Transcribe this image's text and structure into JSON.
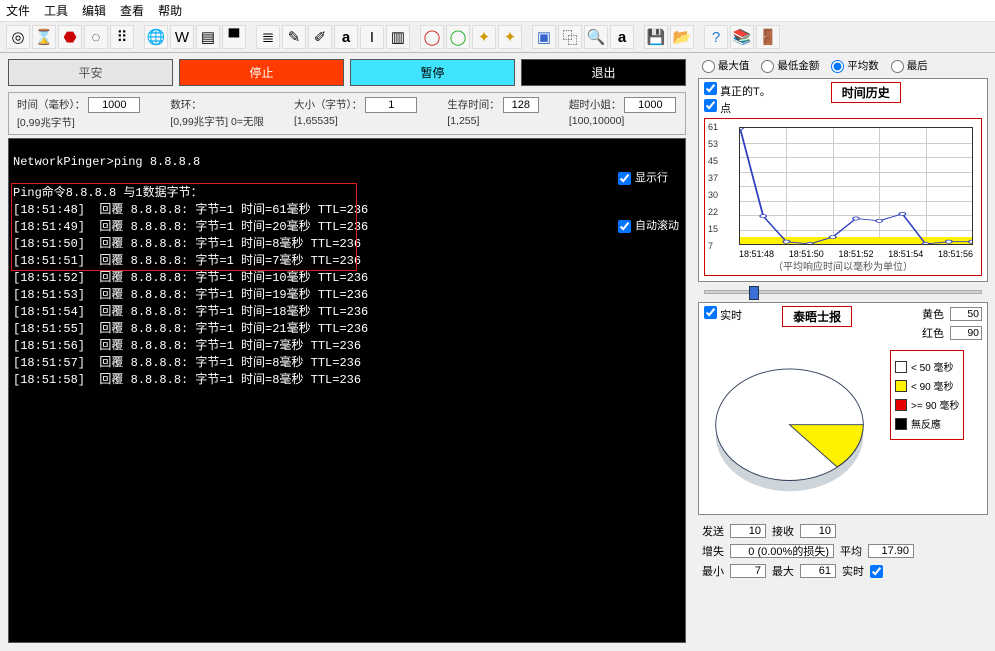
{
  "menu": {
    "file": "文件",
    "tools": "工具",
    "edit": "编辑",
    "view": "查看",
    "help": "帮助"
  },
  "buttons": {
    "ping": "平安",
    "stop": "停止",
    "pause": "暂停",
    "exit": "退出"
  },
  "params": {
    "time_label": "时间（毫秒）：",
    "time_hint": "[0,99兆字节]",
    "time_val": "1000",
    "count_label": "数环：",
    "count_hint": "[0,99兆字节] 0=无限",
    "count_val": "",
    "size_label": "大小（字节）：",
    "size_hint": "[1,65535]",
    "size_val": "1",
    "ttl_label": "生存时间：",
    "ttl_hint": "[1,255]",
    "ttl_val": "128",
    "timeout_label": "超时小姐：",
    "timeout_hint": "[100,10000]",
    "timeout_val": "1000"
  },
  "console": {
    "prompt": "NetworkPinger>ping 8.8.8.8",
    "header": "Ping命令8.8.8.8 与1数据字节：",
    "lines": [
      "[18:51:48]  回覆 8.8.8.8: 字节=1 时间=61毫秒 TTL=236",
      "[18:51:49]  回覆 8.8.8.8: 字节=1 时间=20毫秒 TTL=236",
      "[18:51:50]  回覆 8.8.8.8: 字节=1 时间=8毫秒 TTL=236",
      "[18:51:51]  回覆 8.8.8.8: 字节=1 时间=7毫秒 TTL=236",
      "[18:51:52]  回覆 8.8.8.8: 字节=1 时间=10毫秒 TTL=236",
      "[18:51:53]  回覆 8.8.8.8: 字节=1 时间=19毫秒 TTL=236",
      "[18:51:54]  回覆 8.8.8.8: 字节=1 时间=18毫秒 TTL=236",
      "[18:51:55]  回覆 8.8.8.8: 字节=1 时间=21毫秒 TTL=236",
      "[18:51:56]  回覆 8.8.8.8: 字节=1 时间=7毫秒 TTL=236",
      "[18:51:57]  回覆 8.8.8.8: 字节=1 时间=8毫秒 TTL=236",
      "[18:51:58]  回覆 8.8.8.8: 字节=1 时间=8毫秒 TTL=236"
    ],
    "show_lines": "显示行",
    "autoscroll": "自动滚动"
  },
  "radios": {
    "max": "最大值",
    "minmoney": "最低金额",
    "avg": "平均数",
    "last": "最后"
  },
  "chart1": {
    "real_t": "真正的T。",
    "point": "点",
    "title": "时间历史",
    "caption": "（平均响应时间以毫秒为单位）",
    "yticks": [
      "61",
      "53",
      "45",
      "37",
      "30",
      "22",
      "15",
      "7"
    ],
    "xticks": [
      "18:51:48",
      "18:51:50",
      "18:51:52",
      "18:51:54",
      "18:51:56"
    ]
  },
  "chart2": {
    "live": "实时",
    "title": "泰晤士报",
    "yellow_label": "黄色",
    "yellow_val": "50",
    "red_label": "红色",
    "red_val": "90",
    "legend": {
      "lt50": "< 50 毫秒",
      "lt90": "< 90 毫秒",
      "ge90": ">= 90 毫秒",
      "noresp": "無反應"
    }
  },
  "stats": {
    "sent_label": "发送",
    "sent": "10",
    "recv_label": "接收",
    "recv": "10",
    "lost_label": "增失",
    "lost": "0 (0.00%的损失)",
    "avg_label": "平均",
    "avg": "17.90",
    "min_label": "最小",
    "min": "7",
    "max_label": "最大",
    "max": "61",
    "realtime": "实时"
  },
  "chart_data": [
    {
      "type": "line",
      "title": "时间历史",
      "xlabel": "time",
      "ylabel": "ms",
      "ylim": [
        7,
        61
      ],
      "x": [
        "18:51:48",
        "18:51:49",
        "18:51:50",
        "18:51:51",
        "18:51:52",
        "18:51:53",
        "18:51:54",
        "18:51:55",
        "18:51:56",
        "18:51:57",
        "18:51:58"
      ],
      "values": [
        61,
        20,
        8,
        7,
        10,
        19,
        18,
        21,
        7,
        8,
        8
      ]
    },
    {
      "type": "pie",
      "title": "泰晤士报",
      "categories": [
        "< 50 毫秒",
        "< 90 毫秒",
        ">= 90 毫秒",
        "無反應"
      ],
      "values": [
        9,
        1,
        0,
        0
      ],
      "colors": [
        "#ffffff",
        "#fff200",
        "#e60000",
        "#000000"
      ]
    }
  ]
}
